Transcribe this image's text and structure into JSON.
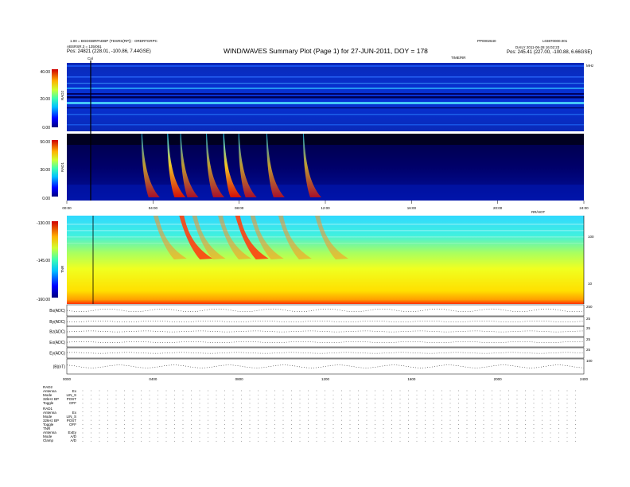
{
  "header": {
    "title": "WIND/WAVES Summary Plot (Page 1) for 27-JUN-2011, DOY = 178",
    "left_line1": "1.00 = BGDGBRPADBP (TDSRS(RP)) · ORDRTGRPC",
    "left_line2": "ABSRSR.3 = 135/061",
    "left_line3": "Pos: 24821 (228.01, -100.86, 7.44GSE)",
    "right_top_a": "PP0002640",
    "right_top_b": "L03870000.001",
    "right_line2": "DAILY  2011-06-28 16:02:23",
    "right_line3": "Pos: 245.41 (227.00, -100.88, 6.66GSE)",
    "cal_label": "Cal",
    "tnr_marker": "TIME/RR",
    "tnr_right": "MHz",
    "mid_right": "RR/HOT"
  },
  "colorbars": {
    "rad2": {
      "label": "RAD2",
      "ticks": [
        "40.00",
        "20.00",
        "0.00"
      ]
    },
    "rad1": {
      "label": "RAD1",
      "ticks": [
        "50.00",
        "30.00",
        "0.00"
      ]
    },
    "tnr": {
      "label": "TNR",
      "ticks": [
        "-130.00",
        "-145.00",
        "-160.00"
      ]
    }
  },
  "time_axis": [
    "00:00",
    "04:00",
    "08:00",
    "12:00",
    "16:00",
    "20:00",
    "24:00"
  ],
  "tnr_freq_ticks": [
    "100",
    "10"
  ],
  "bottom_time_axis": [
    "0000",
    "0400",
    "0800",
    "1200",
    "1600",
    "2000",
    "2400"
  ],
  "line_panels": [
    {
      "label": "Bx(ADC)",
      "right": "250"
    },
    {
      "label": "By(ADC)",
      "right": "25"
    },
    {
      "label": "Bz(ADC)",
      "right": "25"
    },
    {
      "label": "Ex(ADC)",
      "right": "25"
    },
    {
      "label": "Ey(ADC)",
      "right": "25"
    },
    {
      "label": "|B|(nT)",
      "right": "100"
    }
  ],
  "status_table": {
    "rad2_header": "RAD2",
    "rad2_rows": [
      {
        "label": "Antenna",
        "value": "Ex"
      },
      {
        "label": "Mode",
        "value": "LIN_S"
      },
      {
        "label": "32kHz BP",
        "value": "POST"
      },
      {
        "label": "Toggle",
        "value": "OFF"
      }
    ],
    "rad1_header": "RAD1",
    "rad1_rows": [
      {
        "label": "Antenna",
        "value": "Ex"
      },
      {
        "label": "Mode",
        "value": "LIN_S"
      },
      {
        "label": "32kHz BP",
        "value": "POST"
      },
      {
        "label": "Toggle",
        "value": "OFF"
      }
    ],
    "tnr_header": "TNR",
    "tnr_rows": [
      {
        "label": "Antenna",
        "value": "ExEy"
      },
      {
        "label": "Mode",
        "value": "A/D"
      },
      {
        "label": "Clamp",
        "value": "A/D"
      }
    ]
  },
  "chart_data": {
    "type": "heatmap",
    "title": "WIND/WAVES Summary Plot (Page 1) for 27-JUN-2011, DOY = 178",
    "x_range_hours": [
      0,
      24
    ],
    "panels": [
      {
        "name": "RAD2",
        "colorbar_range": [
          0,
          40
        ]
      },
      {
        "name": "RAD1",
        "colorbar_range": [
          0,
          50
        ]
      },
      {
        "name": "TNR",
        "colorbar_range": [
          -160,
          -130
        ]
      }
    ],
    "radio_bursts_hours": [
      3.5,
      4.7,
      5.3,
      6.5,
      7.3,
      8.0,
      9.3,
      11.0
    ],
    "cal_marker_hour": 1.2
  }
}
